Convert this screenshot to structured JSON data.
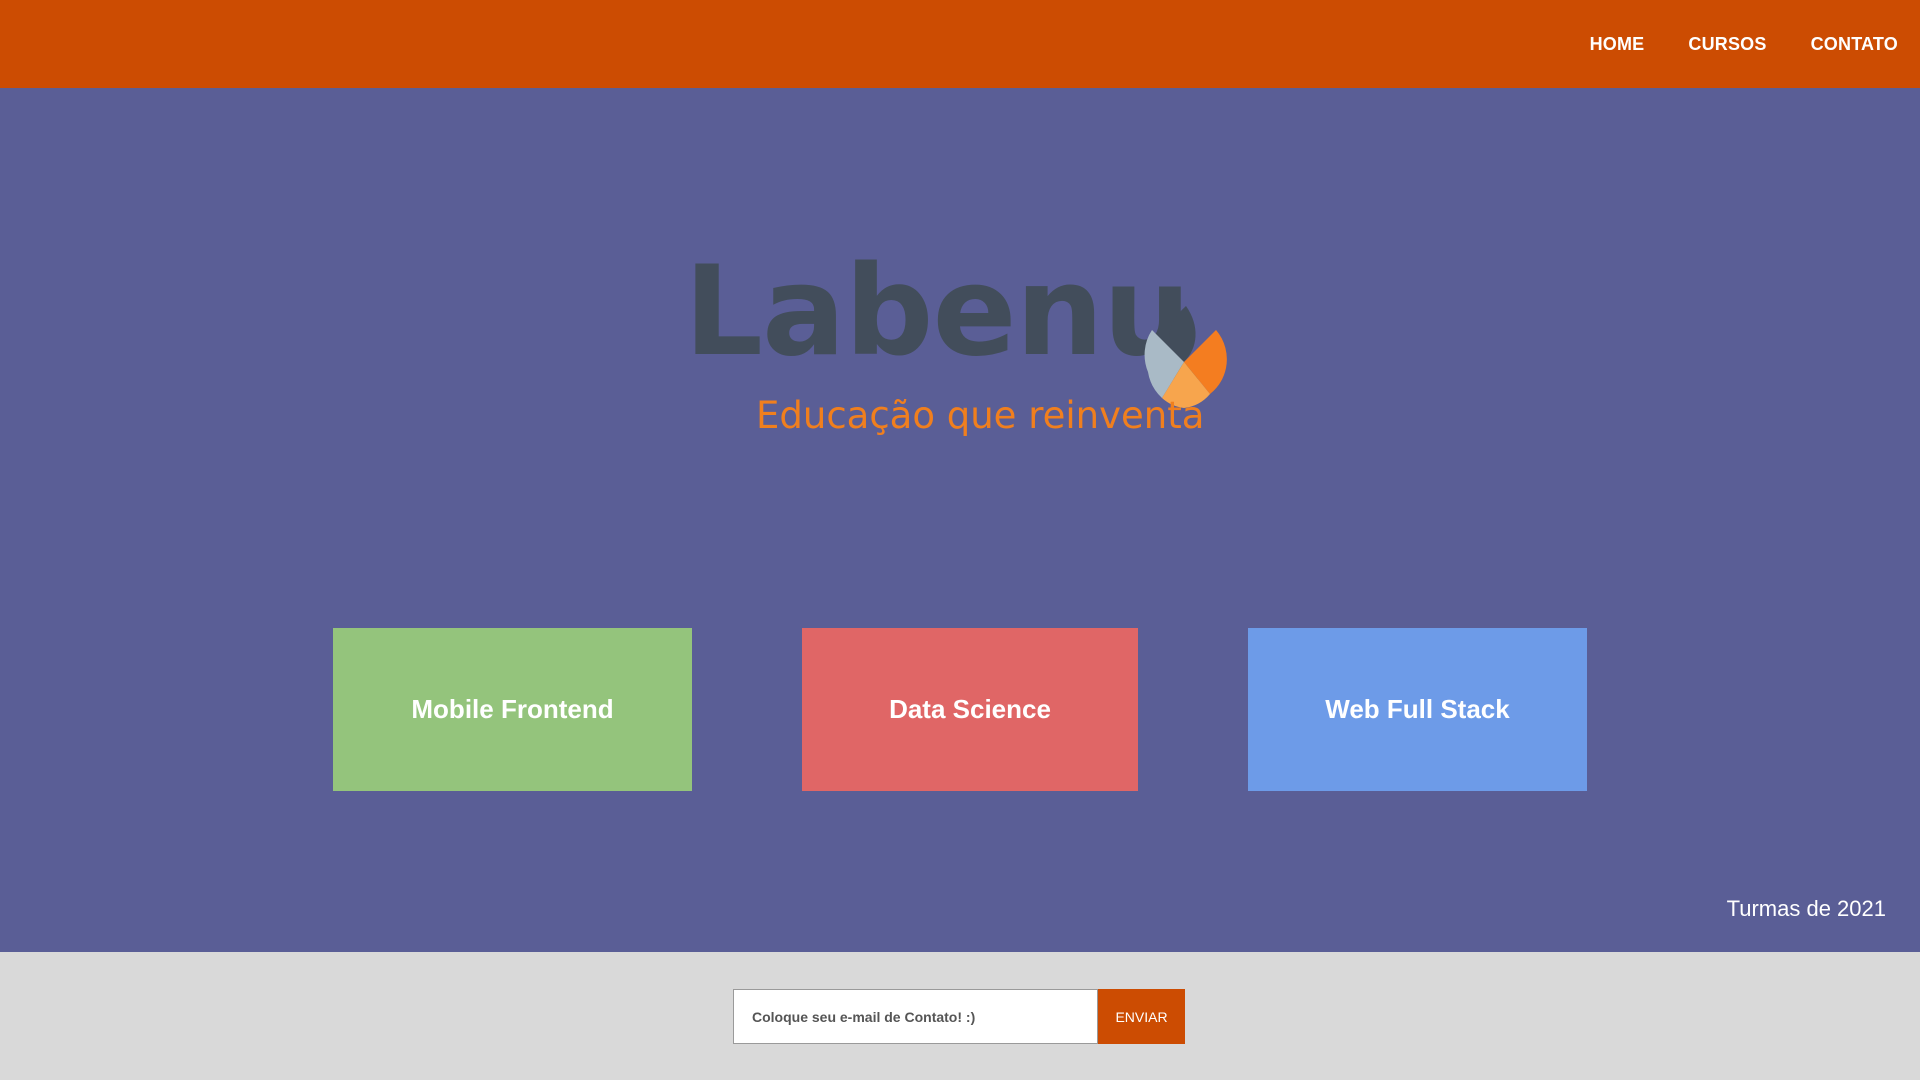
{
  "colors": {
    "header_bg": "#cc4c02",
    "hero_bg": "#5a5e96",
    "footer_bg": "#d9d9d9",
    "mobile_card": "#94c47c",
    "data_card": "#e06666",
    "web_card": "#6d9be8",
    "logo_text": "#424d5b",
    "tagline": "#f07f1e"
  },
  "nav": {
    "home": "HOME",
    "cursos": "CURSOS",
    "contato": "CONTATO"
  },
  "logo": {
    "name": "Labenu",
    "tagline": "Educação que reinventa",
    "icon": "flame-logo-icon"
  },
  "courses": [
    {
      "label": "Mobile Frontend"
    },
    {
      "label": "Data Science"
    },
    {
      "label": "Web Full Stack"
    }
  ],
  "caption": "Turmas de 2021",
  "footer": {
    "email_placeholder": "Coloque seu e-mail de Contato! :)",
    "submit_label": "ENVIAR"
  }
}
